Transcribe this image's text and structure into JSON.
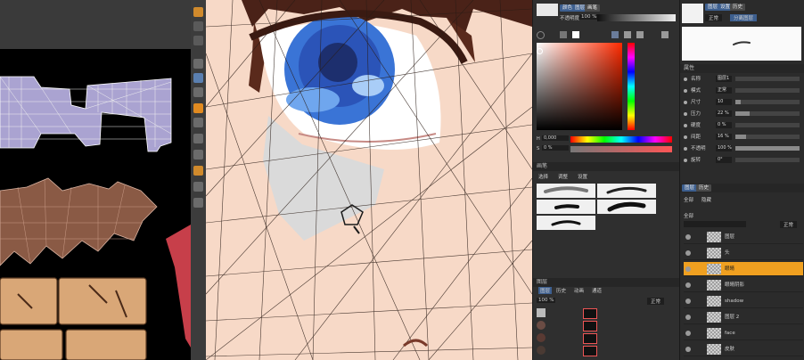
{
  "color_panel": {
    "opacity_label": "不透明度",
    "opacity_value": "100 %",
    "tabs": [
      "颜色",
      "图层",
      "画笔"
    ],
    "hue_value": "0,000",
    "sat_value": "0 %",
    "brush_header": "画笔",
    "brush_tabs": [
      "选择",
      "调整",
      "设置"
    ],
    "layers_header": "图层",
    "layers_tabs": [
      "图层",
      "历史",
      "动画",
      "通道"
    ],
    "layers_opacity": "100 %",
    "layers_mode": "正常"
  },
  "right_panel": {
    "top_tabs": [
      "图层",
      "设置",
      "历史"
    ],
    "top_mode": "正常",
    "top_extra": "分离图层",
    "props_header": "属性",
    "props": [
      {
        "label": "名称",
        "value": "图层1",
        "fill": 0
      },
      {
        "label": "模式",
        "value": "正常",
        "fill": 0
      },
      {
        "label": "尺寸",
        "value": "10",
        "fill": 0.08
      },
      {
        "label": "压力",
        "value": "22 %",
        "fill": 0.22
      },
      {
        "label": "硬度",
        "value": "0 %",
        "fill": 0
      },
      {
        "label": "间距",
        "value": "16 %",
        "fill": 0.16
      },
      {
        "label": "不透明",
        "value": "100 %",
        "fill": 1
      },
      {
        "label": "旋转",
        "value": "0°",
        "fill": 0
      }
    ],
    "layers_tabs": [
      "图层",
      "历史"
    ],
    "layers_sub": [
      "全部",
      "隐藏"
    ],
    "layer_group_label": "全部",
    "layers_mode": "正常",
    "layers": [
      {
        "name": "图层",
        "selected": false
      },
      {
        "name": "头",
        "selected": false
      },
      {
        "name": "眼睛",
        "selected": true
      },
      {
        "name": "眼睛阴影",
        "selected": false
      },
      {
        "name": "shadow",
        "selected": false
      },
      {
        "name": "图层 2",
        "selected": false
      },
      {
        "name": "face",
        "selected": false
      },
      {
        "name": "皮肤",
        "selected": false
      }
    ]
  }
}
